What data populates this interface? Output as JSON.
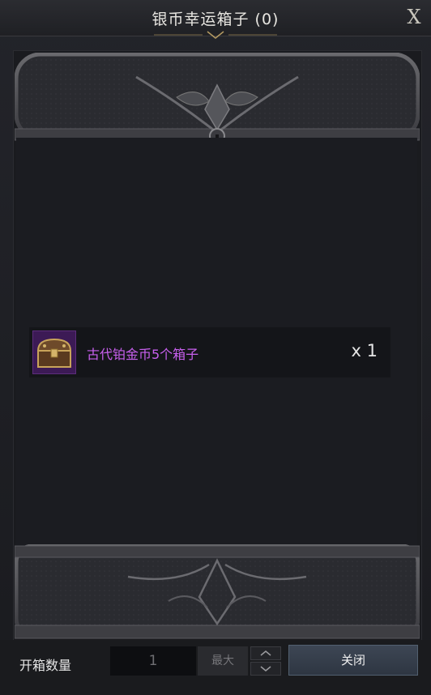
{
  "window": {
    "title": "银币幸运箱子 (0)",
    "close_glyph": "X"
  },
  "items": [
    {
      "name": "古代铂金币5个箱子",
      "quantity": "x 1",
      "icon": "treasure-chest-icon",
      "rarity_color": "#c860ee"
    }
  ],
  "footer": {
    "quantity_label": "开箱数量",
    "quantity_value": "1",
    "max_label": "最大",
    "close_label": "关闭"
  }
}
